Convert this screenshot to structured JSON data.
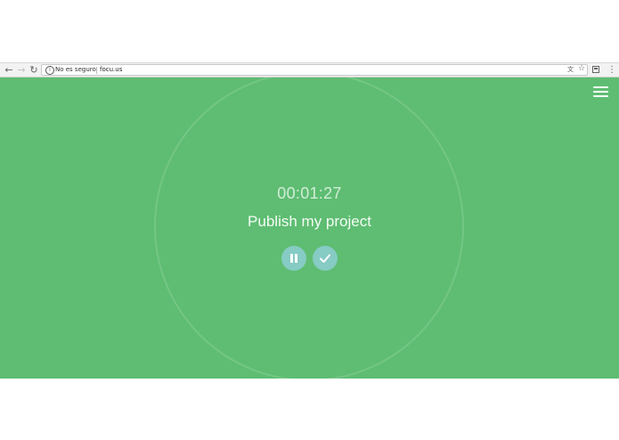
{
  "browser": {
    "back_icon": "←",
    "forward_icon": "→",
    "reload_icon": "↻",
    "info_icon": "i",
    "security_label": "No es seguro",
    "url": "focu.us",
    "translate_icon": "文",
    "star_icon": "☆",
    "menu_icon": "⋮"
  },
  "app": {
    "timer": "00:01:27",
    "task_title": "Publish my project"
  },
  "colors": {
    "background": "#5ebd72",
    "button": "#86cbc4"
  }
}
